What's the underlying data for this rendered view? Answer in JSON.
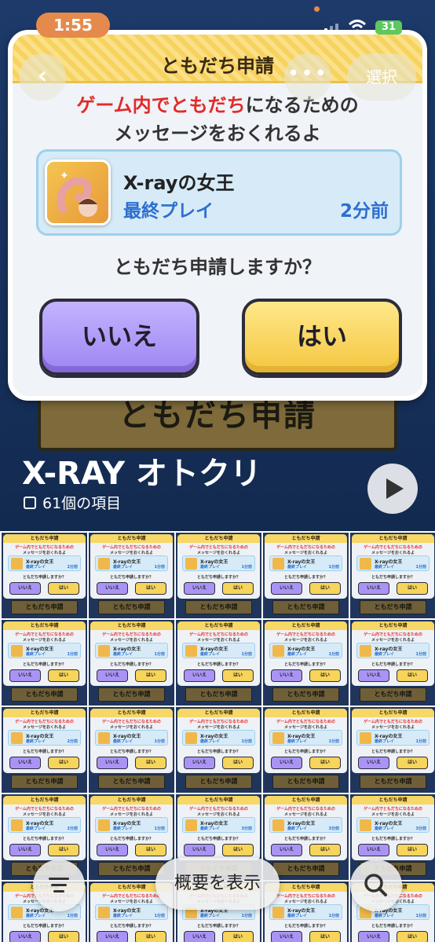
{
  "status": {
    "time": "1:55",
    "battery": "31"
  },
  "nav": {
    "back_icon": "chevron-left-icon",
    "more_icon": "ellipsis-icon",
    "select_label": "選択"
  },
  "dialog": {
    "title": "ともだち申請",
    "message_red": "ゲーム内でともだち",
    "message_rest": "になるための",
    "message_line2": "メッセージをおくれるよ",
    "player_name": "X-rayの女王",
    "last_play_label": "最終プレイ",
    "last_play_time": "2分前",
    "question": "ともだち申請しますか？",
    "no_label": "いいえ",
    "yes_label": "はい"
  },
  "background_banner": "ともだち申請",
  "album": {
    "title": "X-RAY オトクリ",
    "count": "61個の項目"
  },
  "thumbnails": {
    "title": "ともだち申請",
    "message_red": "ゲーム内でともだちになるための",
    "message_line2": "メッセージをおくれるよ",
    "player_name": "X-rayの女王",
    "last_play_label": "最終プレイ",
    "question": "ともだち申請しますか？",
    "no_label": "いいえ",
    "yes_label": "はい",
    "banner": "ともだち申請",
    "times": [
      "2分前",
      "1分前",
      "1分前",
      "1分前",
      "1分前",
      "1分前",
      "1分前",
      "1分前",
      "1分前",
      "1分前",
      "2分前",
      "1分前",
      "1分前",
      "1分前",
      "1分前",
      "2分前",
      "1分前",
      "3分前",
      "3分前",
      "3分前",
      "1分前",
      "1分前",
      "1分前",
      "1分前",
      "1分前"
    ]
  },
  "toolbar": {
    "menu_icon": "list-icon",
    "summary_label": "概要を表示",
    "search_icon": "search-icon"
  },
  "colors": {
    "accent_red": "#e22a2a",
    "accent_blue": "#2d6fd0",
    "no_button": "#9d86f2",
    "yes_button": "#f4c640",
    "header_yellow": "#f6d25e"
  }
}
